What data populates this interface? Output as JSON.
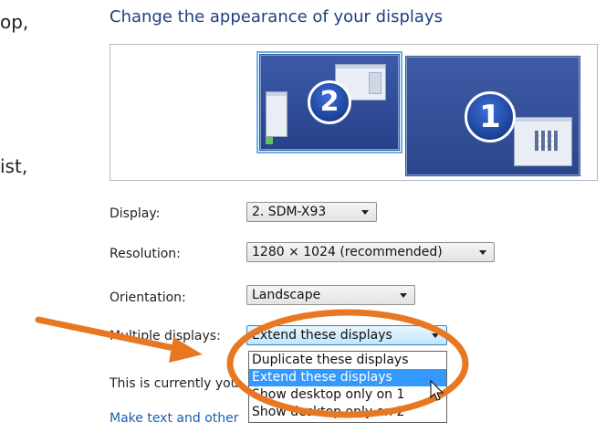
{
  "left_text": {
    "frag_1": "op,",
    "frag_2": "ist,"
  },
  "heading": "Change the appearance of your displays",
  "preview": {
    "monitor_2_number": "2",
    "monitor_1_number": "1"
  },
  "display": {
    "label": "Display:",
    "value": "2. SDM-X93"
  },
  "resolution": {
    "label": "Resolution:",
    "value": "1280 × 1024 (recommended)"
  },
  "orientation": {
    "label": "Orientation:",
    "value": "Landscape"
  },
  "multiple_displays": {
    "label": "Multiple displays:",
    "value": "Extend these displays",
    "options": [
      "Duplicate these displays",
      "Extend these displays",
      "Show desktop only on 1",
      "Show desktop only on 2"
    ]
  },
  "status_text": "This is currently you",
  "link_text": "Make text and other",
  "colors": {
    "heading": "#1f3f82",
    "selection": "#3399ff",
    "annotation": "#e87722",
    "link": "#1a5fb4"
  },
  "icons": [
    "monitor-icon",
    "dropdown-arrow-icon",
    "mouse-cursor-icon",
    "annotation-arrow-icon",
    "annotation-ellipse-icon"
  ]
}
